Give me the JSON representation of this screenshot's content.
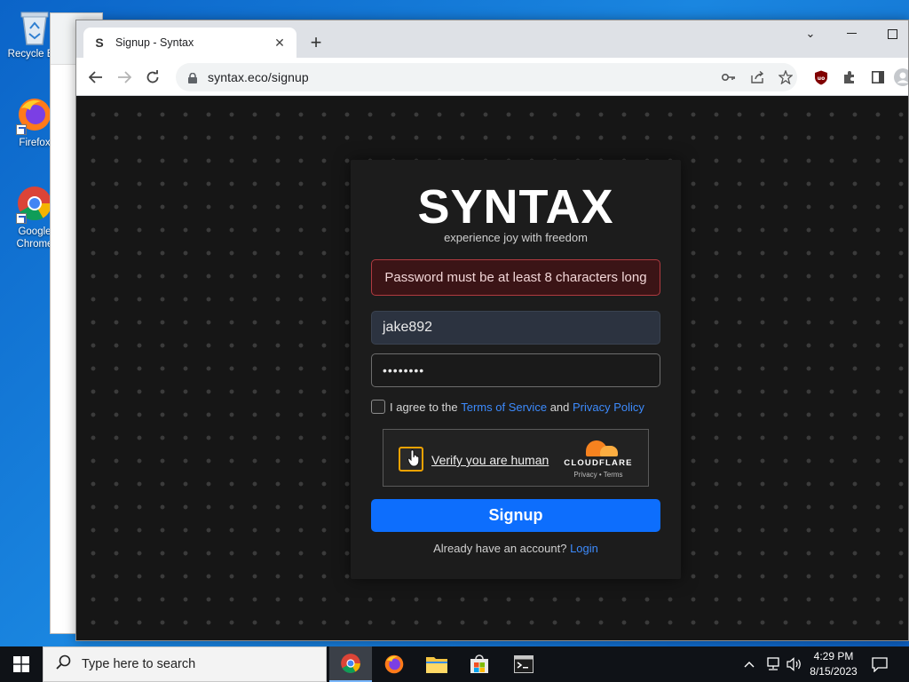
{
  "desktop": {
    "icons": [
      {
        "label": "Recycle Bin",
        "icon": "recycle-bin-icon"
      },
      {
        "label": "Firefox",
        "icon": "firefox-icon"
      },
      {
        "label": "Google Chrome",
        "icon": "chrome-icon"
      }
    ]
  },
  "browser": {
    "tab_title": "Signup - Syntax",
    "tab_favicon": "S",
    "url": "syntax.eco/signup"
  },
  "page": {
    "brand": "SYNTAX",
    "tagline": "experience joy with freedom",
    "error_message": "Password must be at least 8 characters long",
    "username_value": "jake892",
    "password_value": "••••••••",
    "agree_prefix": "I agree to the",
    "terms_link": "Terms of Service",
    "agree_and": "and",
    "privacy_link": "Privacy Policy",
    "captcha_label": "Verify you are human",
    "captcha_brand": "CLOUDFLARE",
    "captcha_privacy": "Privacy",
    "captcha_sep": "•",
    "captcha_terms": "Terms",
    "signup_button": "Signup",
    "login_prompt": "Already have an account?",
    "login_link": "Login",
    "colors": {
      "accent": "#0d6efd",
      "error_border": "#b03a40",
      "captcha_box": "#f0a200"
    }
  },
  "taskbar": {
    "search_placeholder": "Type here to search",
    "time": "4:29 PM",
    "date": "8/15/2023"
  }
}
